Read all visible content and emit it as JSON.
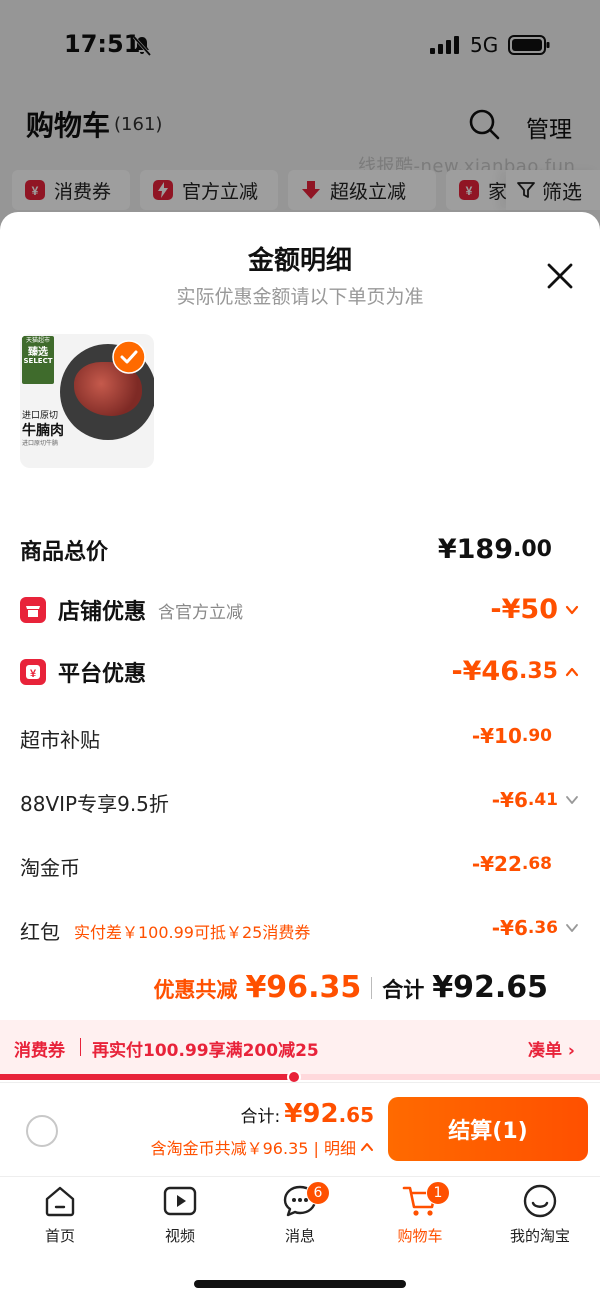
{
  "status_bar": {
    "time": "17:51",
    "network": "5G"
  },
  "header": {
    "title": "购物车",
    "count": "(161)",
    "manage": "管理"
  },
  "watermark": "线报酷-new.xianbao.fun",
  "filters": {
    "chips": [
      "消费券",
      "官方立减",
      "超级立减",
      "家"
    ],
    "filter_label": "筛选"
  },
  "sheet": {
    "title": "金额明细",
    "subtitle": "实际优惠金额请以下单页为准",
    "product": {
      "brand_top": "天猫超市",
      "brand_main": "臻选",
      "brand_sub": "SELECT",
      "caption1": "进口原切",
      "caption2": "牛腩肉",
      "caption3": "进口原切牛腩",
      "selected": true
    },
    "lines": {
      "goods_total": {
        "label": "商品总价",
        "value_int": "¥189",
        "value_frac": ".00"
      },
      "shop": {
        "label": "店铺优惠",
        "note": "含官方立减",
        "value_int": "-¥50",
        "value_frac": ""
      },
      "platform": {
        "label": "平台优惠",
        "value_int": "-¥46",
        "value_frac": ".35"
      },
      "supermarket": {
        "label": "超市补贴",
        "value_int": "-¥10",
        "value_frac": ".90"
      },
      "vip": {
        "label": "88VIP专享9.5折",
        "value_int": "-¥6",
        "value_frac": ".41"
      },
      "coin": {
        "label": "淘金币",
        "value_int": "-¥22",
        "value_frac": ".68"
      },
      "redpacket": {
        "label": "红包",
        "note": "实付差￥100.99可抵￥25消费券",
        "value_int": "-¥6",
        "value_frac": ".36"
      }
    },
    "summary": {
      "discount_label": "优惠共减",
      "discount_int": "¥96",
      "discount_frac": ".35",
      "total_label": "合计",
      "total_int": "¥92",
      "total_frac": ".65"
    },
    "coupon": {
      "tag": "消费券",
      "text": "再实付100.99享满200减25",
      "link": "凑单 ›",
      "progress": 0.49
    }
  },
  "checkout": {
    "sum_label": "合计:",
    "sum_int": "¥92",
    "sum_frac": ".65",
    "detail": "含淘金币共减￥96.35 | 明细",
    "button": "结算(1)"
  },
  "tabs": [
    {
      "label": "首页",
      "badge": ""
    },
    {
      "label": "视频",
      "badge": ""
    },
    {
      "label": "消息",
      "badge": "6"
    },
    {
      "label": "购物车",
      "badge": "1"
    },
    {
      "label": "我的淘宝",
      "badge": ""
    }
  ],
  "colors": {
    "accent": "#ff5000",
    "coupon": "#e8233a"
  }
}
